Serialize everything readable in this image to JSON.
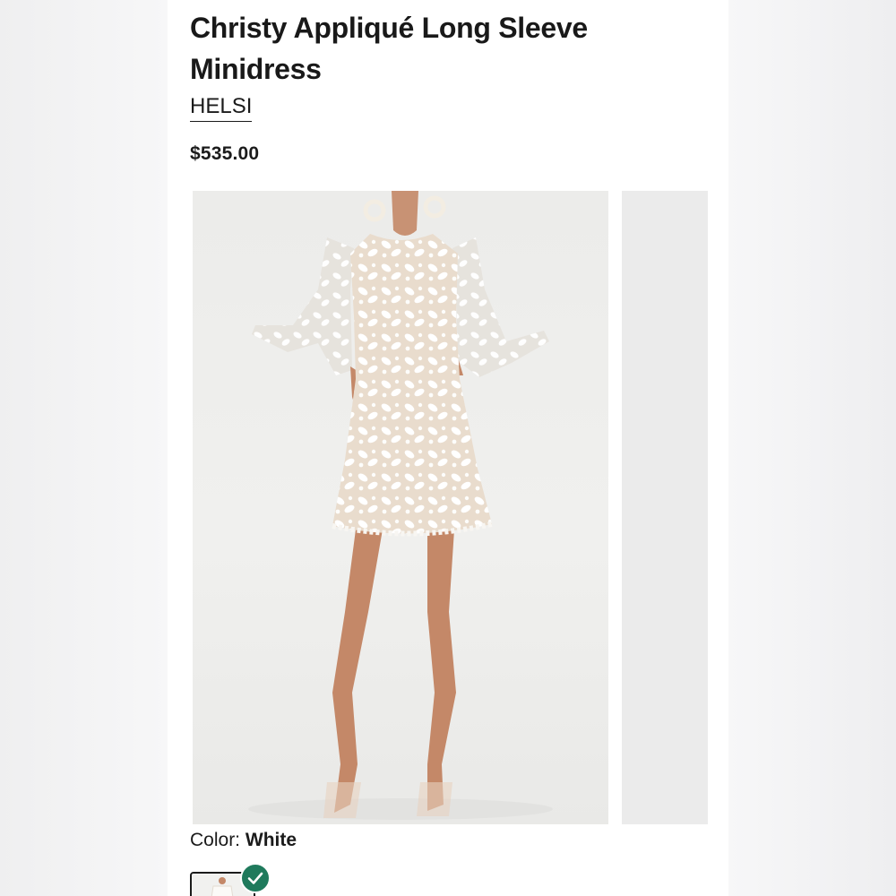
{
  "product": {
    "title": "Christy Appliqué Long Sleeve Minidress",
    "brand": "HELSI",
    "price": "$535.00"
  },
  "gallery": {
    "main_image_icon": "dress-photo",
    "next_image_icon": "dress-photo-partial"
  },
  "color": {
    "label": "Color:",
    "value": "White",
    "swatch_icon": "dress-thumbnail",
    "selected_icon": "check-icon",
    "selected_color": "#1f7a5c"
  }
}
